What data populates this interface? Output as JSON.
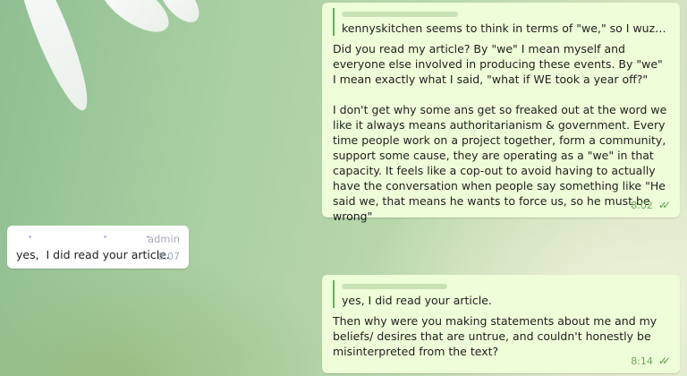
{
  "messages": [
    {
      "reply_to_text": "kennyskitchen seems to think in terms of \"we,\" so I wuz respondi...",
      "text": "Did you read my article? By \"we\" I mean myself and everyone else involved in producing these events. By \"we\" I mean exactly what I said, \"what if WE took a year off?\"\n\nI don't get why some ans get so freaked out at the word we like it always means authoritarianism & government. Every time people work on a project together, form a community, support some cause, they are operating as a \"we\" in that capacity. It feels like a cop-out to avoid having to actually have the conversation when people say something like \"He said we, that means he wants to force us, so he must be wrong\"",
      "time": "8:02"
    },
    {
      "role_badge": "admin",
      "text": "yes,  I did read your article.",
      "time": "8:07"
    },
    {
      "reply_to_text": "yes,  I did read your article.",
      "text": "Then why were you making statements about me and my beliefs/ desires that are untrue, and couldn't honestly be misinterpreted from the text?",
      "time": "8:14"
    }
  ],
  "icons": {
    "read_receipt": "double-check-icon"
  },
  "colors": {
    "outgoing_bubble": "#eefed8",
    "incoming_bubble": "#ffffff",
    "accent": "#5eb15a"
  }
}
